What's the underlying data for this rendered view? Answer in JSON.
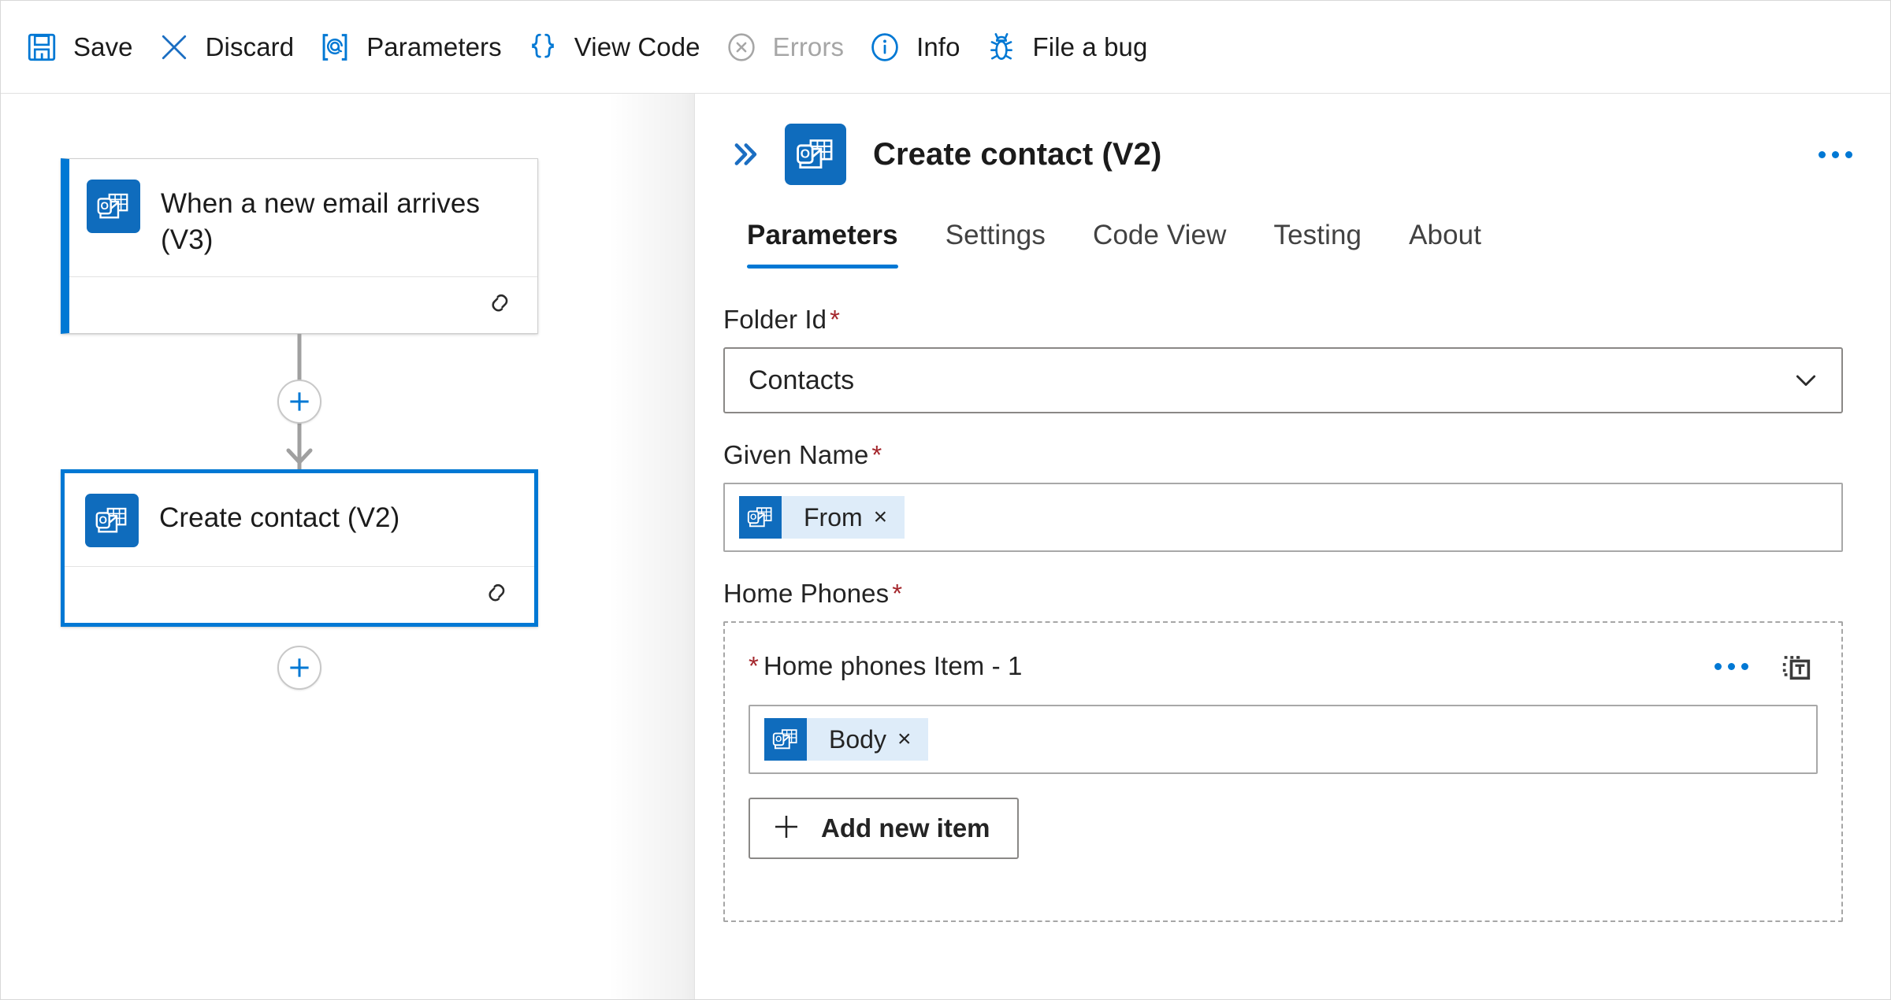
{
  "toolbar": {
    "items": [
      {
        "label": "Save",
        "icon": "save-icon",
        "disabled": false
      },
      {
        "label": "Discard",
        "icon": "discard-icon",
        "disabled": false
      },
      {
        "label": "Parameters",
        "icon": "parameters-icon",
        "disabled": false
      },
      {
        "label": "View Code",
        "icon": "view-code-icon",
        "disabled": false
      },
      {
        "label": "Errors",
        "icon": "errors-icon",
        "disabled": true
      },
      {
        "label": "Info",
        "icon": "info-icon",
        "disabled": false
      },
      {
        "label": "File a bug",
        "icon": "bug-icon",
        "disabled": false
      }
    ]
  },
  "canvas": {
    "trigger_node": {
      "title": "When a new email arrives (V3)",
      "icon": "outlook-icon",
      "footer_icon": "link-icon",
      "selected": false
    },
    "action_node": {
      "title": "Create contact (V2)",
      "icon": "outlook-icon",
      "footer_icon": "link-icon",
      "selected": true
    },
    "insert_button_label": "+",
    "tail_button_label": "+"
  },
  "panel": {
    "collapse_icon": "chevron-double-right-icon",
    "title": "Create contact (V2)",
    "icon": "outlook-icon",
    "more_icon": "more-horizontal-icon",
    "tabs": [
      {
        "label": "Parameters",
        "active": true
      },
      {
        "label": "Settings",
        "active": false
      },
      {
        "label": "Code View",
        "active": false
      },
      {
        "label": "Testing",
        "active": false
      },
      {
        "label": "About",
        "active": false
      }
    ],
    "fields": {
      "folder_id": {
        "label": "Folder Id",
        "required_marker": "*",
        "value": "Contacts",
        "chevron_icon": "chevron-down-icon"
      },
      "given_name": {
        "label": "Given Name",
        "required_marker": "*",
        "token": {
          "label": "From",
          "icon": "outlook-icon",
          "remove_label": "×"
        }
      },
      "home_phones": {
        "label": "Home Phones",
        "required_marker": "*",
        "item": {
          "required_marker": "*",
          "label": "Home phones Item - 1",
          "more_icon": "more-horizontal-icon",
          "toggle_icon": "text-mode-icon",
          "token": {
            "label": "Body",
            "icon": "outlook-icon",
            "remove_label": "×"
          }
        },
        "add_button": {
          "label": "Add new item",
          "icon": "plus-icon"
        }
      }
    }
  },
  "colors": {
    "accent": "#0078d4",
    "brand_tile": "#0f6cbd",
    "required": "#a4262c",
    "token_bg": "#deecf9",
    "disabled_text": "#a6a6a6"
  }
}
